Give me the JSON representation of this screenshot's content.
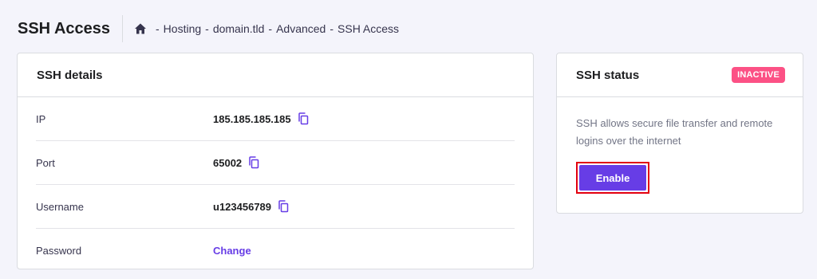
{
  "header": {
    "title": "SSH Access",
    "breadcrumb": [
      {
        "label": "Hosting"
      },
      {
        "label": "domain.tld"
      },
      {
        "label": "Advanced"
      },
      {
        "label": "SSH Access"
      }
    ],
    "separator": "-"
  },
  "details": {
    "title": "SSH details",
    "rows": [
      {
        "label": "IP",
        "value": "185.185.185.185"
      },
      {
        "label": "Port",
        "value": "65002"
      },
      {
        "label": "Username",
        "value": "u123456789"
      },
      {
        "label": "Password",
        "action": "Change"
      }
    ]
  },
  "status": {
    "title": "SSH status",
    "badge": "INACTIVE",
    "description": "SSH allows secure file transfer and remote logins over the internet",
    "button_label": "Enable"
  },
  "colors": {
    "accent": "#673de6",
    "badge": "#fc5185",
    "highlight_outline": "#e3000f"
  },
  "icons": {
    "home": "home-icon",
    "copy": "copy-icon"
  }
}
